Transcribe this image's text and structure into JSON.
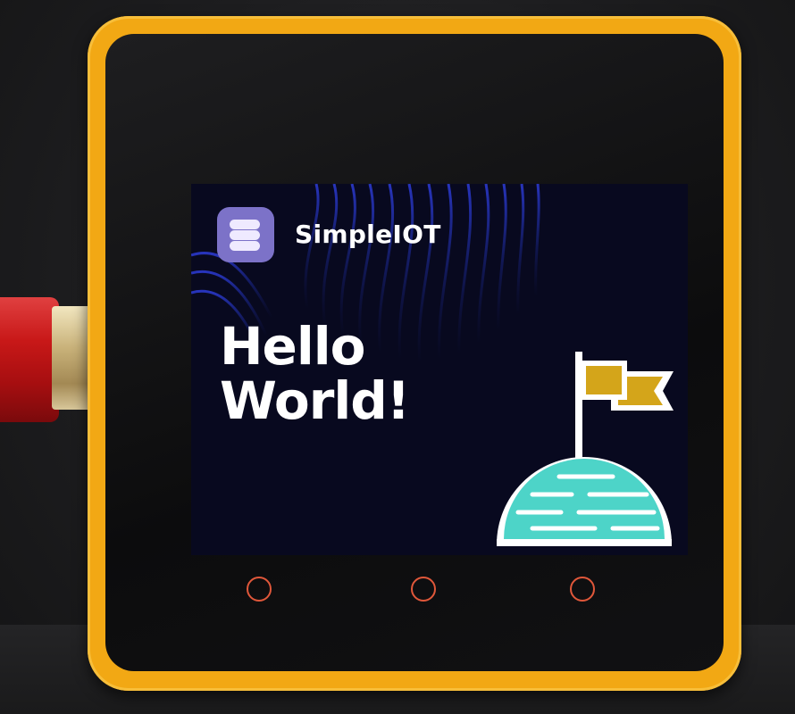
{
  "screen": {
    "brand": "SimpleIOT",
    "heading_line1": "Hello",
    "heading_line2": "World!"
  },
  "device": {
    "case_color": "#f2a814",
    "touch_buttons": [
      "left-button",
      "center-button",
      "right-button"
    ]
  },
  "colors": {
    "screen_bg": "#08091f",
    "logo_tile": "#7c72c8",
    "planet": "#4dd4c8",
    "flag": "#d4a51a",
    "button_ring": "#e0573a"
  },
  "icons": {
    "logo": "stacked-bars-logo-icon",
    "illustration": "planet-with-flag-icon"
  }
}
